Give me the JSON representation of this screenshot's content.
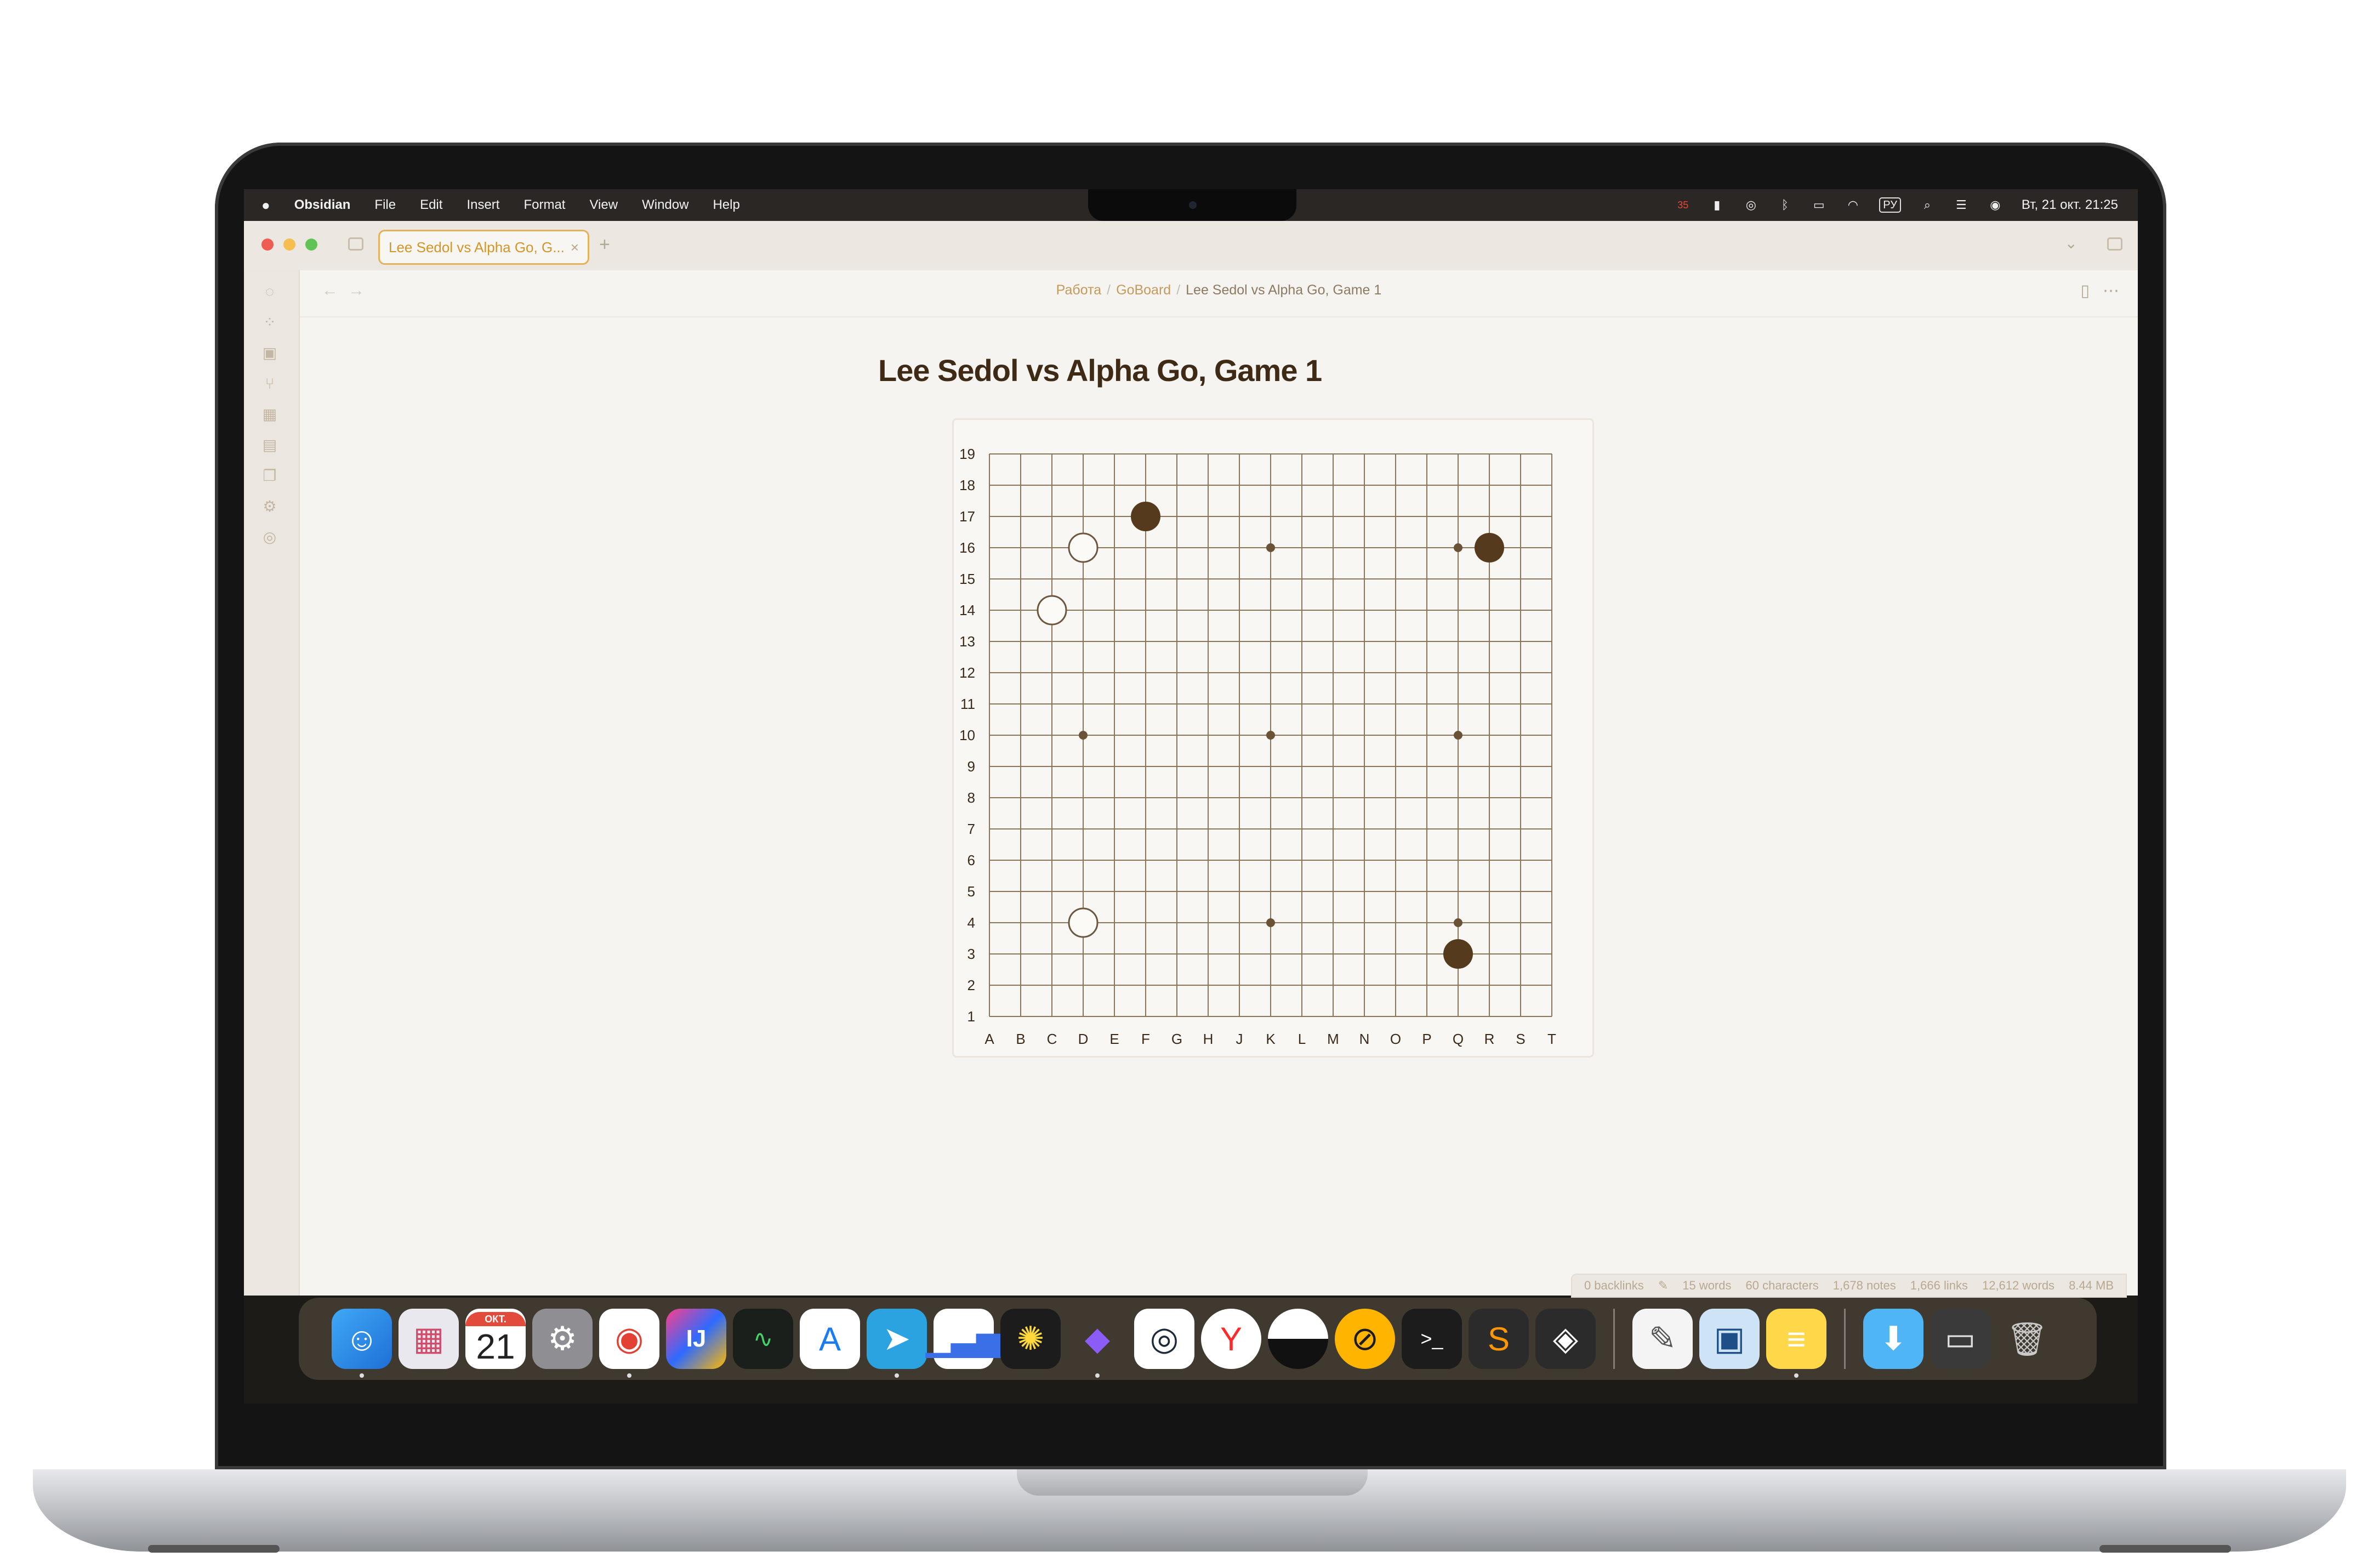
{
  "menubar": {
    "app_name": "Obsidian",
    "items": [
      "File",
      "Edit",
      "Insert",
      "Format",
      "View",
      "Window",
      "Help"
    ],
    "keyboard_layout": "РУ",
    "datetime": "Вт, 21 окт. 21:25",
    "notification_count": "35"
  },
  "tab": {
    "title": "Lee Sedol vs Alpha Go, G...",
    "close": "×",
    "new": "+"
  },
  "breadcrumb": {
    "items": [
      "Работа",
      "GoBoard",
      "Lee Sedol vs Alpha Go, Game 1"
    ],
    "separator": "/"
  },
  "page": {
    "title": "Lee Sedol vs Alpha Go, Game 1"
  },
  "go_board": {
    "size": 19,
    "columns": [
      "A",
      "B",
      "C",
      "D",
      "E",
      "F",
      "G",
      "H",
      "J",
      "K",
      "L",
      "M",
      "N",
      "O",
      "P",
      "Q",
      "R",
      "S",
      "T"
    ],
    "rows": [
      "19",
      "18",
      "17",
      "16",
      "15",
      "14",
      "13",
      "12",
      "11",
      "10",
      "9",
      "8",
      "7",
      "6",
      "5",
      "4",
      "3",
      "2",
      "1"
    ],
    "star_points": [
      "D16",
      "K16",
      "Q16",
      "D10",
      "K10",
      "Q10",
      "D4",
      "K4",
      "Q4"
    ],
    "stones": [
      {
        "color": "black",
        "pos": "F17"
      },
      {
        "color": "black",
        "pos": "R16"
      },
      {
        "color": "black",
        "pos": "Q3"
      },
      {
        "color": "white",
        "pos": "D16"
      },
      {
        "color": "white",
        "pos": "C14"
      },
      {
        "color": "white",
        "pos": "D4"
      }
    ],
    "colors": {
      "line": "#8a7558",
      "black_stone": "#553a1e",
      "white_stone": "#fbfaf7",
      "white_outline": "#6b5640"
    }
  },
  "statusbar": {
    "backlinks": "0 backlinks",
    "words": "15 words",
    "characters": "60 characters",
    "notes": "1,678 notes",
    "links": "1,666 links",
    "total_words": "12,612 words",
    "size": "8.44 MB"
  },
  "dock": {
    "apps": [
      "finder-icon",
      "launchpad-icon",
      "calendar-icon",
      "system-settings-icon",
      "chrome-icon",
      "intellij-icon",
      "activity-monitor-icon",
      "app-store-icon",
      "telegram-icon",
      "charts-icon",
      "star-app-icon",
      "obsidian-icon",
      "proxyman-icon",
      "yandex-browser-icon",
      "half-circle-app-icon",
      "pen-app-icon",
      "terminal-icon",
      "sublime-text-icon",
      "cube-app-icon",
      "textedit-icon",
      "preview-icon",
      "notes-icon",
      "downloads-folder-icon",
      "screen-capture-icon",
      "trash-icon"
    ],
    "calendar_month": "ОКТ.",
    "calendar_day": "21"
  }
}
